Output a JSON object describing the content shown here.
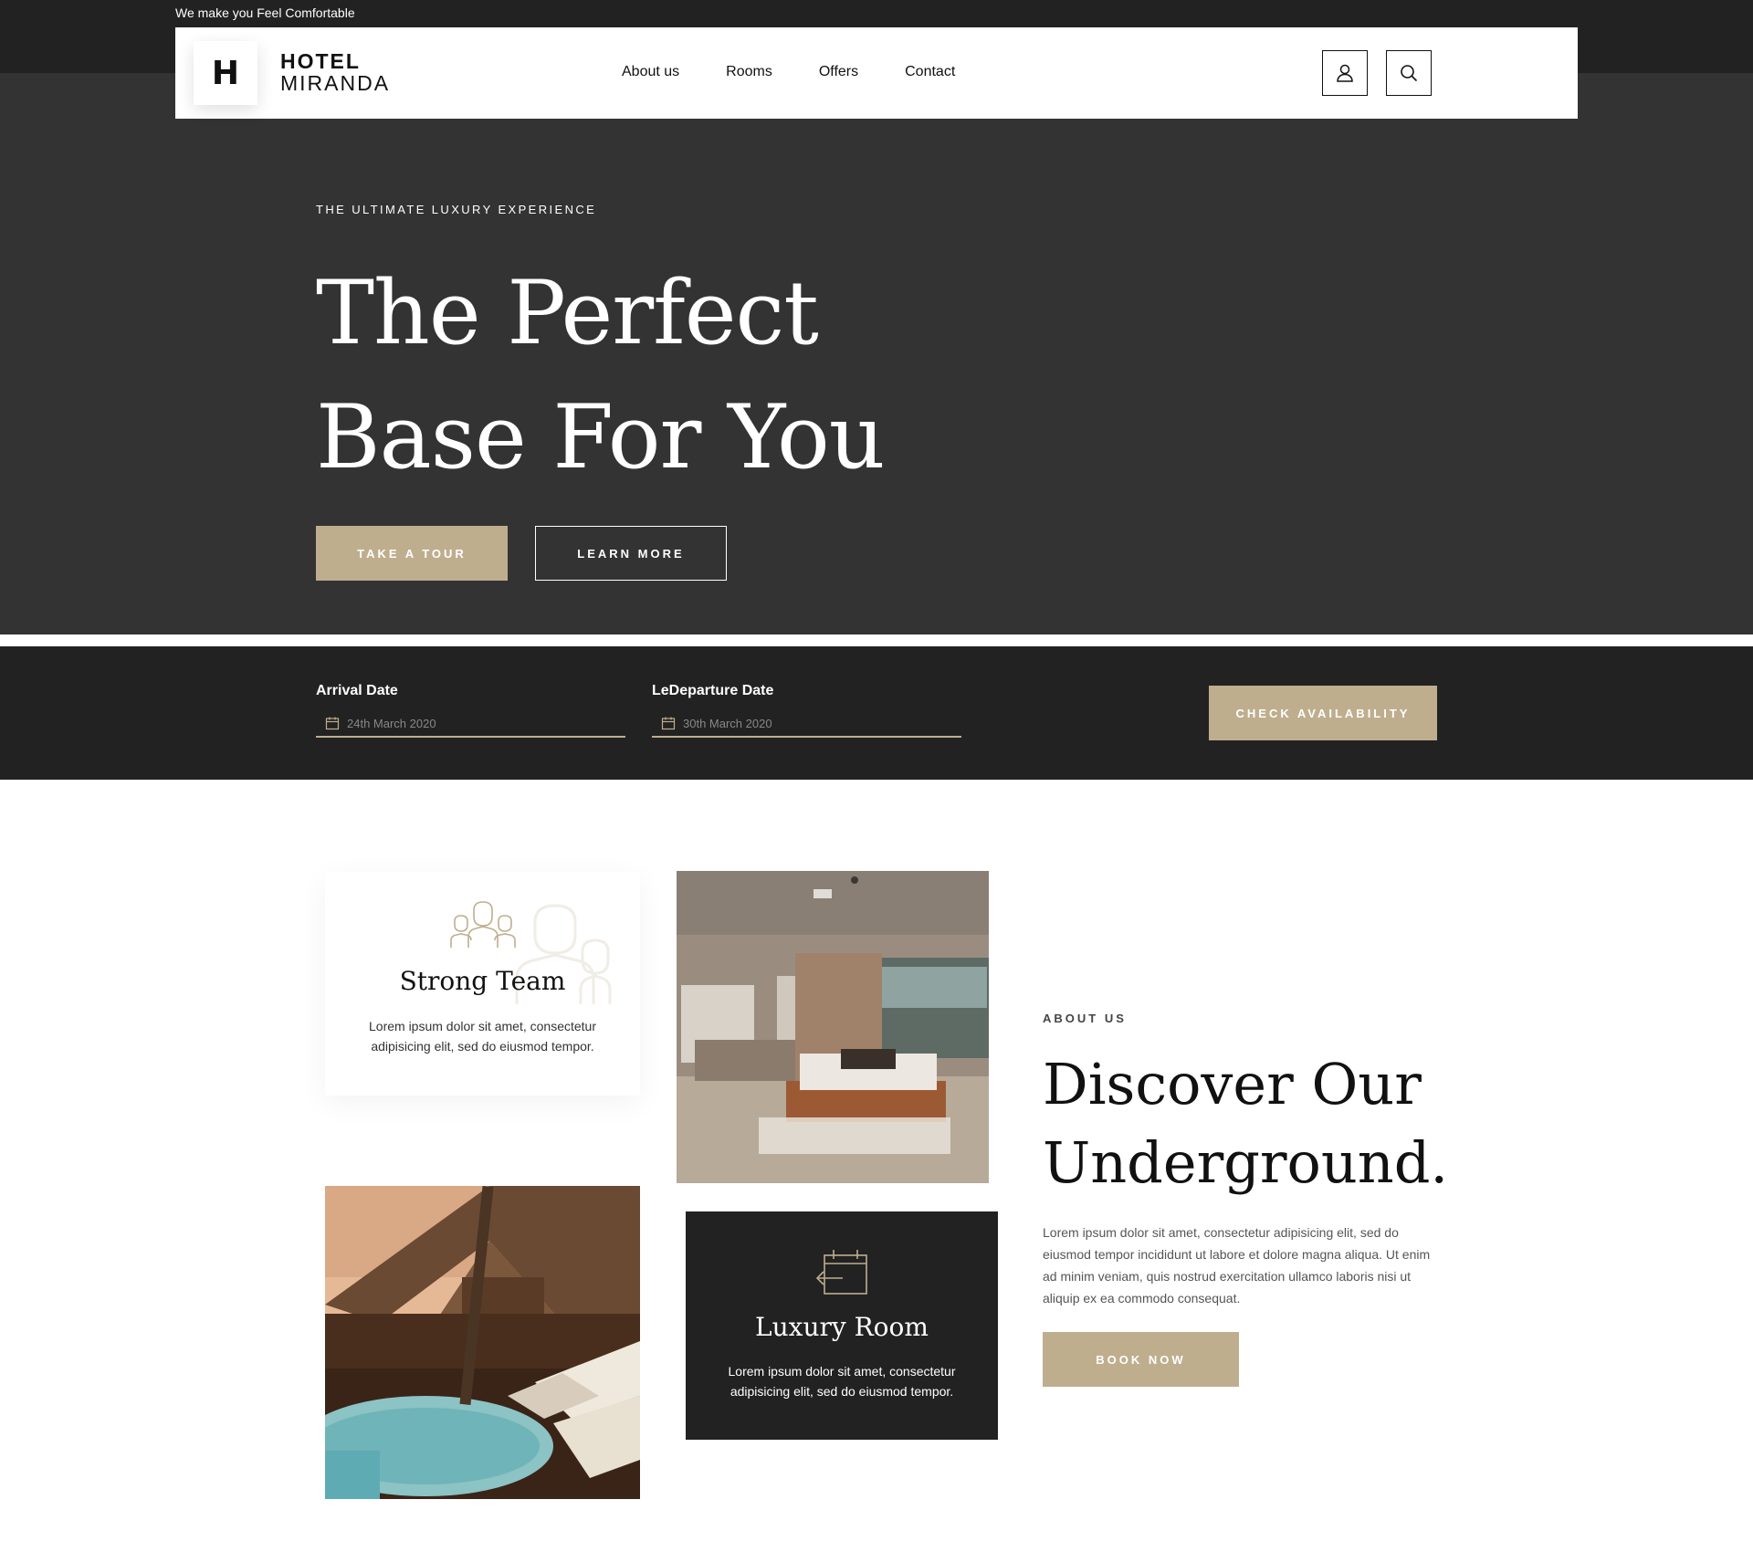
{
  "topbar": {
    "tagline": "We make you Feel Comfortable"
  },
  "brand": {
    "logo_letter": "H",
    "line1": "HOTEL",
    "line2": "MIRANDA"
  },
  "nav": {
    "items": [
      {
        "label": "About us"
      },
      {
        "label": "Rooms"
      },
      {
        "label": "Offers"
      },
      {
        "label": "Contact"
      }
    ]
  },
  "icons": {
    "account": "user-icon",
    "search": "search-icon"
  },
  "hero": {
    "eyebrow": "THE ULTIMATE LUXURY EXPERIENCE",
    "title_line1": "The Perfect",
    "title_line2": "Base For You",
    "primary_button": "TAKE A TOUR",
    "secondary_button": "LEARN MORE"
  },
  "booking": {
    "arrival_label": "Arrival Date",
    "arrival_value": "24th March 2020",
    "departure_label": "LeDeparture Date",
    "departure_value": "30th March 2020",
    "check_button": "CHECK AVAILABILITY"
  },
  "features": {
    "team": {
      "title": "Strong Team",
      "text": "Lorem ipsum dolor sit amet, consectetur adipisicing elit, sed do eiusmod tempor."
    },
    "room": {
      "title": "Luxury Room",
      "text": "Lorem ipsum dolor sit amet, consectetur adipisicing elit, sed do eiusmod tempor."
    }
  },
  "about": {
    "eyebrow": "ABOUT US",
    "title_line1": "Discover Our",
    "title_line2": "Underground.",
    "text": "Lorem ipsum dolor sit amet, consectetur adipisicing elit, sed do eiusmod tempor incididunt ut labore et dolore magna aliqua. Ut enim ad minim veniam, quis nostrud exercitation ullamco laboris nisi ut aliquip ex ea commodo consequat.",
    "button": "BOOK NOW"
  },
  "colors": {
    "accent": "#bfae8e",
    "dark": "#222222",
    "hero": "#333333"
  }
}
